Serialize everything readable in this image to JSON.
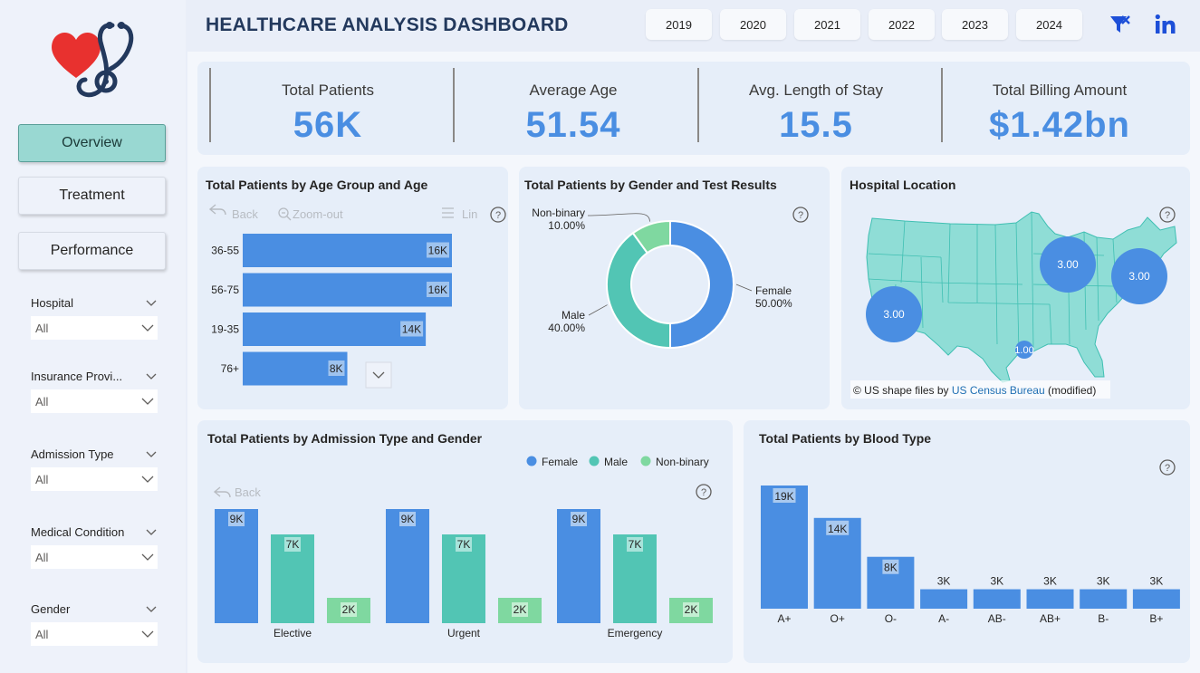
{
  "header": {
    "title": "HEALTHCARE ANALYSIS DASHBOARD",
    "years": [
      "2019",
      "2020",
      "2021",
      "2022",
      "2023",
      "2024"
    ]
  },
  "nav": {
    "overview": "Overview",
    "treatment": "Treatment",
    "performance": "Performance"
  },
  "filters": [
    {
      "label": "Hospital",
      "value": "All"
    },
    {
      "label": "Insurance Provi...",
      "value": "All"
    },
    {
      "label": "Admission Type",
      "value": "All"
    },
    {
      "label": "Medical Condition",
      "value": "All"
    },
    {
      "label": "Gender",
      "value": "All"
    }
  ],
  "kpis": [
    {
      "label": "Total Patients",
      "value": "56K"
    },
    {
      "label": "Average Age",
      "value": "51.54"
    },
    {
      "label": "Avg. Length of Stay",
      "value": "15.5"
    },
    {
      "label": "Total Billing Amount",
      "value": "$1.42bn"
    }
  ],
  "age_card": {
    "title": "Total Patients by Age Group and Age",
    "toolbar": {
      "back": "Back",
      "zoom_out": "Zoom-out",
      "lin": "Lin"
    }
  },
  "gender_card": {
    "title": "Total Patients by Gender and Test Results"
  },
  "map_card": {
    "title": "Hospital Location",
    "attribution_prefix": "© US shape files by ",
    "attribution_link": "US Census Bureau",
    "attribution_suffix": " (modified)",
    "bubbles": [
      "3.00",
      "3.00",
      "3.00",
      "1.00"
    ]
  },
  "admission_card": {
    "title": "Total Patients by Admission Type and Gender",
    "back": "Back"
  },
  "blood_card": {
    "title": "Total Patients by Blood Type"
  },
  "colors": {
    "female": "#4a8ee2",
    "male": "#52c5b4",
    "nonbinary": "#7fd8a0",
    "accent": "#99d8d2",
    "title": "#23395d"
  },
  "chart_data": [
    {
      "type": "bar",
      "orientation": "horizontal",
      "title": "Total Patients by Age Group and Age",
      "categories": [
        "36-55",
        "56-75",
        "19-35",
        "76+"
      ],
      "values": [
        16000,
        16000,
        14000,
        8000
      ],
      "labels": [
        "16K",
        "16K",
        "14K",
        "8K"
      ]
    },
    {
      "type": "pie",
      "title": "Total Patients by Gender and Test Results",
      "categories": [
        "Female",
        "Male",
        "Non-binary"
      ],
      "values": [
        50.0,
        40.0,
        10.0
      ],
      "labels": [
        "50.00%",
        "40.00%",
        "10.00%"
      ]
    },
    {
      "type": "bar",
      "title": "Total Patients by Admission Type and Gender",
      "categories": [
        "Elective",
        "Urgent",
        "Emergency"
      ],
      "legend": "top-right",
      "series": [
        {
          "name": "Female",
          "values": [
            9000,
            9000,
            9000
          ],
          "labels": [
            "9K",
            "9K",
            "9K"
          ]
        },
        {
          "name": "Male",
          "values": [
            7000,
            7000,
            7000
          ],
          "labels": [
            "7K",
            "7K",
            "7K"
          ]
        },
        {
          "name": "Non-binary",
          "values": [
            2000,
            2000,
            2000
          ],
          "labels": [
            "2K",
            "2K",
            "2K"
          ]
        }
      ]
    },
    {
      "type": "bar",
      "title": "Total Patients by Blood Type",
      "categories": [
        "A+",
        "O+",
        "O-",
        "A-",
        "AB-",
        "AB+",
        "B-",
        "B+"
      ],
      "values": [
        19000,
        14000,
        8000,
        3000,
        3000,
        3000,
        3000,
        3000
      ],
      "labels": [
        "19K",
        "14K",
        "8K",
        "3K",
        "3K",
        "3K",
        "3K",
        "3K"
      ]
    }
  ]
}
